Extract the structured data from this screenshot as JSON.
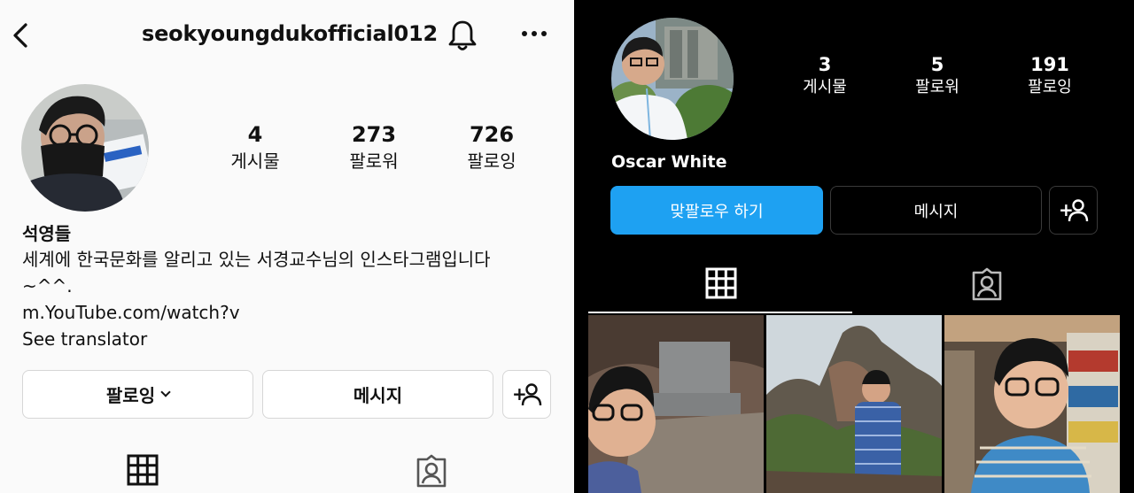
{
  "left_profile": {
    "username": "seokyoungdukofficial012",
    "stats": [
      {
        "value": "4",
        "label": "게시물"
      },
      {
        "value": "273",
        "label": "팔로워"
      },
      {
        "value": "726",
        "label": "팔로잉"
      }
    ],
    "bio": {
      "name": "석영들",
      "line1": "세계에 한국문화를 알리고 있는 서경교수님의 인스타그램입니다",
      "line2": "~^^.",
      "link": "m.YouTube.com/watch?v",
      "translate": "See translator"
    },
    "buttons": {
      "following": "팔로잉",
      "message": "메시지",
      "add_person": "+"
    },
    "icons": [
      "back-icon",
      "bell-icon",
      "more-icon",
      "grid-icon",
      "tagged-icon",
      "chevron-down-icon",
      "add-person-icon"
    ]
  },
  "right_profile": {
    "name": "Oscar White",
    "stats": [
      {
        "value": "3",
        "label": "게시물"
      },
      {
        "value": "5",
        "label": "팔로워"
      },
      {
        "value": "191",
        "label": "팔로잉"
      }
    ],
    "buttons": {
      "follow_back": "맞팔로우 하기",
      "message": "메시지",
      "add_person": "+"
    },
    "colors": {
      "accent": "#1ea1f2",
      "background": "#000000"
    },
    "posts": [
      "post-photo-1",
      "post-photo-2",
      "post-photo-3"
    ]
  }
}
